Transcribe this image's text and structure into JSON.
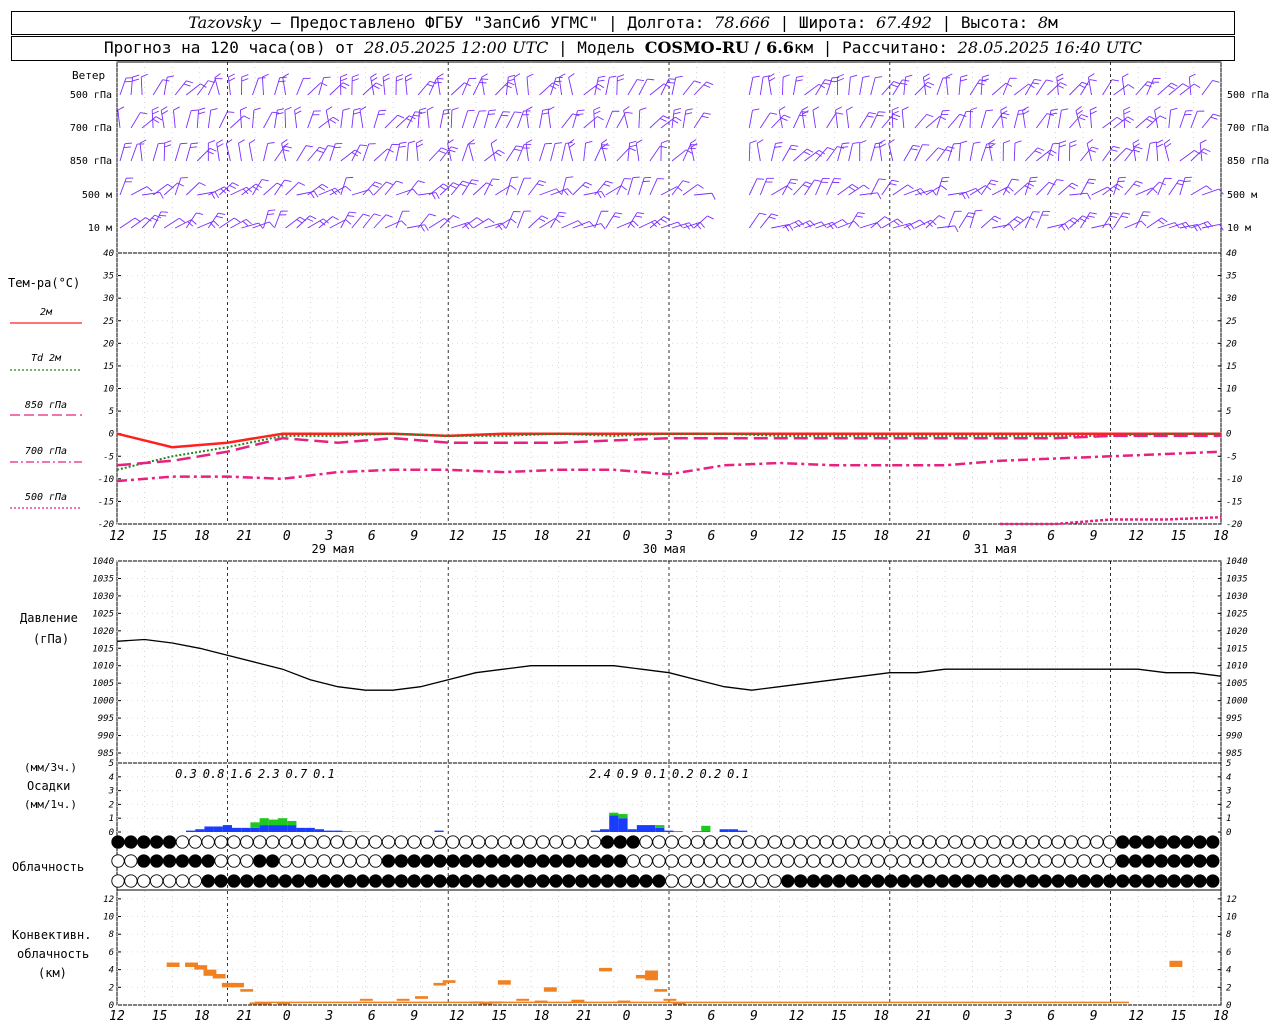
{
  "header": {
    "line1": {
      "station": "Tazovsky",
      "provider": " – Предоставлено ФГБУ \"ЗапСиб УГМС\" | Долгота: ",
      "lon": "78.666",
      "lat_label": " | Широта: ",
      "lat": "67.492",
      "alt_label": " | Высота: ",
      "alt": "8",
      "alt_unit": "м"
    },
    "line2": {
      "forecast": "Прогноз на 120 часа(ов) от ",
      "start": "28.05.2025 12:00 UTC",
      "model_label": " | Модель ",
      "model": "COSMO-RU / 6.6",
      "model_unit": "км | Рассчитано: ",
      "computed": "28.05.2025 16:40 UTC"
    }
  },
  "axis": {
    "hour_labels": [
      "12",
      "15",
      "18",
      "21",
      "0",
      "3",
      "6",
      "9",
      "12",
      "15",
      "18",
      "21",
      "0",
      "3",
      "6",
      "9",
      "12",
      "15",
      "18",
      "21",
      "0",
      "3",
      "6",
      "9",
      "12",
      "15",
      "18"
    ],
    "day_labels": [
      "29 мая",
      "30 мая",
      "31 мая"
    ]
  },
  "wind_panel": {
    "title": "Ветер",
    "levels": [
      "500 гПа",
      "700 гПа",
      "850 гПа",
      "500 м",
      "10 м"
    ],
    "levels_right": [
      "500 гПа",
      "700 гПа",
      "850 гПа",
      "500 м",
      "10 м"
    ],
    "color": "#7a2cff"
  },
  "temp_panel": {
    "title": "Тем-ра(°C)",
    "legend": [
      {
        "label": "2м",
        "color": "#ff2020",
        "style": "solid"
      },
      {
        "label": "Td 2м",
        "color": "#1a8a1a",
        "style": "dotted"
      },
      {
        "label": "850 гПа",
        "color": "#e8207f",
        "style": "longdash"
      },
      {
        "label": "700 гПа",
        "color": "#e8207f",
        "style": "dashdot"
      },
      {
        "label": "500 гПа",
        "color": "#e8207f",
        "style": "dotted"
      }
    ],
    "yticks": [
      "40",
      "35",
      "30",
      "25",
      "20",
      "15",
      "10",
      "5",
      "0",
      "-5",
      "-10",
      "-15",
      "-20"
    ]
  },
  "pressure_panel": {
    "title": "Давление",
    "unit": "(гПа)",
    "yticks": [
      "1040",
      "1035",
      "1030",
      "1025",
      "1020",
      "1015",
      "1010",
      "1005",
      "1000",
      "995",
      "990",
      "985"
    ]
  },
  "precip_panel": {
    "unit_top": "(мм/3ч.)",
    "title": "Осадки",
    "unit_bottom": "(мм/1ч.)",
    "yticks": [
      "5",
      "4",
      "3",
      "2",
      "1",
      "0"
    ],
    "totals_3h": [
      {
        "hour": 9,
        "value": "0.3"
      },
      {
        "hour": 12,
        "value": "0.8"
      },
      {
        "hour": 15,
        "value": "1.6"
      },
      {
        "hour": 18,
        "value": "2.3"
      },
      {
        "hour": 21,
        "value": "0.7"
      },
      {
        "hour": 24,
        "value": "0.1"
      },
      {
        "hour": 54,
        "value": "2.4"
      },
      {
        "hour": 57,
        "value": "0.9"
      },
      {
        "hour": 60,
        "value": "0.1"
      },
      {
        "hour": 63,
        "value": "0.2"
      },
      {
        "hour": 66,
        "value": "0.2"
      },
      {
        "hour": 69,
        "value": "0.1"
      }
    ]
  },
  "cloud_panel": {
    "title": "Облачность"
  },
  "conv_panel": {
    "title_line1": "Конвективн.",
    "title_line2": "облачность",
    "unit": "(км)",
    "yticks": [
      "12",
      "10",
      "8",
      "6",
      "4",
      "2",
      "0"
    ],
    "color": "#f08020"
  },
  "chart_data": [
    {
      "type": "line",
      "title": "Тем-ра(°C)",
      "x_unit": "hours since 28.05.2025 12:00 UTC",
      "ylim": [
        -20,
        40
      ],
      "x": [
        0,
        6,
        12,
        18,
        24,
        30,
        36,
        42,
        48,
        54,
        60,
        66,
        72,
        78,
        84,
        90,
        96,
        102,
        108,
        114,
        120
      ],
      "series": [
        {
          "name": "2м",
          "values": [
            0,
            -3,
            -2,
            0,
            0,
            0,
            -0.5,
            0,
            0,
            0,
            0,
            0,
            0,
            0,
            0,
            0,
            0,
            0,
            0,
            0,
            0
          ]
        },
        {
          "name": "Td 2м",
          "values": [
            -8,
            -5,
            -3,
            -0.5,
            -0.5,
            0,
            -0.5,
            -0.5,
            0,
            -0.5,
            0,
            0,
            -0.5,
            -0.5,
            -0.5,
            -0.5,
            -0.5,
            -0.5,
            -0.5,
            0,
            0
          ]
        },
        {
          "name": "850 гПа",
          "values": [
            -7,
            -6,
            -4,
            -1,
            -2,
            -1,
            -2,
            -2,
            -2,
            -1.5,
            -1,
            -1,
            -1,
            -1,
            -1,
            -1,
            -1,
            -1,
            -0.5,
            -0.5,
            -0.5
          ]
        },
        {
          "name": "700 гПа",
          "values": [
            -10.5,
            -9.5,
            -9.5,
            -10,
            -8.5,
            -8,
            -8,
            -8.5,
            -8,
            -8,
            -9,
            -7,
            -6.5,
            -7,
            -7,
            -7,
            -6,
            -5.5,
            -5,
            -4.5,
            -4
          ]
        },
        {
          "name": "500 гПа",
          "values": [
            null,
            null,
            null,
            null,
            null,
            null,
            null,
            null,
            null,
            null,
            null,
            null,
            null,
            null,
            null,
            null,
            -21,
            -20.5,
            -19,
            -19,
            -18.5
          ]
        }
      ]
    },
    {
      "type": "line",
      "title": "Давление",
      "ylabel": "(гПа)",
      "x_unit": "hours since 28.05.2025 12:00 UTC",
      "ylim": [
        985,
        1040
      ],
      "x": [
        0,
        3,
        6,
        9,
        12,
        15,
        18,
        21,
        24,
        27,
        30,
        33,
        36,
        39,
        42,
        45,
        48,
        51,
        54,
        57,
        60,
        63,
        66,
        69,
        72,
        75,
        78,
        81,
        84,
        87,
        90,
        93,
        96,
        99,
        102,
        105,
        108,
        111,
        114,
        117,
        120
      ],
      "series": [
        {
          "name": "Давление",
          "values": [
            1017,
            1017.5,
            1016.5,
            1015,
            1013,
            1011,
            1009,
            1006,
            1004,
            1003,
            1003,
            1004,
            1006,
            1008,
            1009,
            1010,
            1010,
            1010,
            1010,
            1009,
            1008,
            1006,
            1004,
            1003,
            1004,
            1005,
            1006,
            1007,
            1008,
            1008,
            1009,
            1009,
            1009,
            1009,
            1009,
            1009,
            1009,
            1009,
            1008,
            1008,
            1007
          ]
        }
      ]
    },
    {
      "type": "bar",
      "title": "Осадки",
      "ylabel": "(мм/1ч.)",
      "ylim": [
        0,
        5
      ],
      "x_unit": "hours since 28.05.2025 12:00 UTC",
      "series": [
        {
          "name": "rain",
          "color": "#1a3cff",
          "x": [
            8,
            9,
            10,
            11,
            12,
            13,
            14,
            15,
            16,
            17,
            18,
            19,
            20,
            21,
            22,
            23,
            24,
            25,
            26,
            27,
            35,
            52,
            53,
            54,
            55,
            56,
            57,
            58,
            59,
            60,
            61,
            63,
            64,
            66,
            67,
            68
          ],
          "values": [
            0.1,
            0.2,
            0.4,
            0.4,
            0.5,
            0.3,
            0.3,
            0.3,
            0.5,
            0.5,
            0.5,
            0.5,
            0.3,
            0.3,
            0.2,
            0.1,
            0.1,
            0.05,
            0.02,
            0.02,
            0.1,
            0.1,
            0.2,
            1.2,
            1.0,
            0.2,
            0.5,
            0.5,
            0.3,
            0.1,
            0.05,
            0.05,
            0.05,
            0.2,
            0.2,
            0.1
          ]
        },
        {
          "name": "snow",
          "color": "#1ec81e",
          "x": [
            15,
            16,
            17,
            18,
            19,
            54,
            55,
            59,
            64
          ],
          "values": [
            0.4,
            0.5,
            0.4,
            0.5,
            0.3,
            0.2,
            0.3,
            0.2,
            0.4
          ]
        }
      ]
    },
    {
      "type": "bar",
      "title": "Конвективн. облачность",
      "ylabel": "(км)",
      "ylim": [
        0,
        13
      ],
      "x_unit": "hours since 28.05.2025 12:00 UTC",
      "series": [
        {
          "name": "conv",
          "color": "#f08020",
          "x": [
            6,
            8,
            9,
            10,
            11,
            12,
            13,
            14,
            15,
            16,
            18,
            27,
            31,
            33,
            35,
            36,
            39,
            40,
            41,
            42,
            44,
            46,
            47,
            50,
            53,
            55,
            57,
            58,
            59,
            60,
            61,
            115
          ],
          "base": [
            4.3,
            4.3,
            4.0,
            3.3,
            3.0,
            2.0,
            2.0,
            1.5,
            0.2,
            0.2,
            0.2,
            0.5,
            0.6,
            0.7,
            2.2,
            2.5,
            0.3,
            0.2,
            0.3,
            2.3,
            0.5,
            0.3,
            1.5,
            0.3,
            3.8,
            0.3,
            3.0,
            2.8,
            1.5,
            0.5,
            0.2,
            4.3
          ],
          "top": [
            4.8,
            4.8,
            4.5,
            4.0,
            3.5,
            2.5,
            2.5,
            1.8,
            0.3,
            0.3,
            0.3,
            0.7,
            0.7,
            1.0,
            2.5,
            2.8,
            0.4,
            0.3,
            0.4,
            2.8,
            0.7,
            0.5,
            2.0,
            0.6,
            4.2,
            0.5,
            3.4,
            3.9,
            1.8,
            0.7,
            0.3,
            5.0
          ]
        }
      ]
    }
  ]
}
